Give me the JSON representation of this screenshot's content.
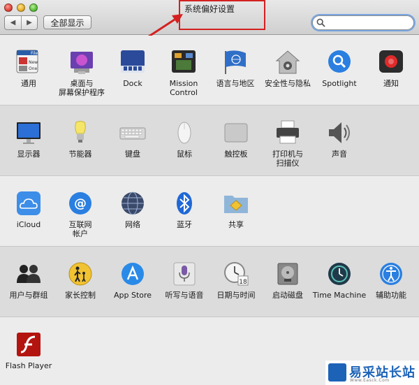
{
  "window": {
    "title": "系统偏好设置"
  },
  "toolbar": {
    "back_label": "◀",
    "forward_label": "▶",
    "show_all_label": "全部显示",
    "search_value": ""
  },
  "rows": [
    [
      {
        "label": "通用",
        "icon": "general-icon"
      },
      {
        "label": "桌面与\n屏幕保护程序",
        "icon": "desktop-icon"
      },
      {
        "label": "Dock",
        "icon": "dock-icon"
      },
      {
        "label": "Mission\nControl",
        "icon": "mission-control-icon"
      },
      {
        "label": "语言与地区",
        "icon": "language-icon"
      },
      {
        "label": "安全性与隐私",
        "icon": "security-icon"
      },
      {
        "label": "Spotlight",
        "icon": "spotlight-icon"
      },
      {
        "label": "通知",
        "icon": "notifications-icon"
      }
    ],
    [
      {
        "label": "显示器",
        "icon": "display-icon"
      },
      {
        "label": "节能器",
        "icon": "energy-saver-icon"
      },
      {
        "label": "键盘",
        "icon": "keyboard-icon"
      },
      {
        "label": "鼠标",
        "icon": "mouse-icon"
      },
      {
        "label": "触控板",
        "icon": "trackpad-icon"
      },
      {
        "label": "打印机与\n扫描仪",
        "icon": "printer-icon"
      },
      {
        "label": "声音",
        "icon": "sound-icon"
      }
    ],
    [
      {
        "label": "iCloud",
        "icon": "icloud-icon"
      },
      {
        "label": "互联网\n帐户",
        "icon": "internet-accounts-icon"
      },
      {
        "label": "网络",
        "icon": "network-icon"
      },
      {
        "label": "蓝牙",
        "icon": "bluetooth-icon"
      },
      {
        "label": "共享",
        "icon": "sharing-icon"
      }
    ],
    [
      {
        "label": "用户与群组",
        "icon": "users-icon"
      },
      {
        "label": "家长控制",
        "icon": "parental-controls-icon"
      },
      {
        "label": "App Store",
        "icon": "app-store-icon"
      },
      {
        "label": "听写与语音",
        "icon": "dictation-icon"
      },
      {
        "label": "日期与时间",
        "icon": "date-time-icon"
      },
      {
        "label": "启动磁盘",
        "icon": "startup-disk-icon"
      },
      {
        "label": "Time Machine",
        "icon": "time-machine-icon"
      },
      {
        "label": "辅助功能",
        "icon": "accessibility-icon"
      }
    ],
    [
      {
        "label": "Flash Player",
        "icon": "flash-player-icon"
      }
    ]
  ],
  "watermark": {
    "text": "易采站长站",
    "sub": "Www.Easck.Com"
  },
  "colors": {
    "accent": "#1a6fe0",
    "annotation": "#d42020"
  }
}
